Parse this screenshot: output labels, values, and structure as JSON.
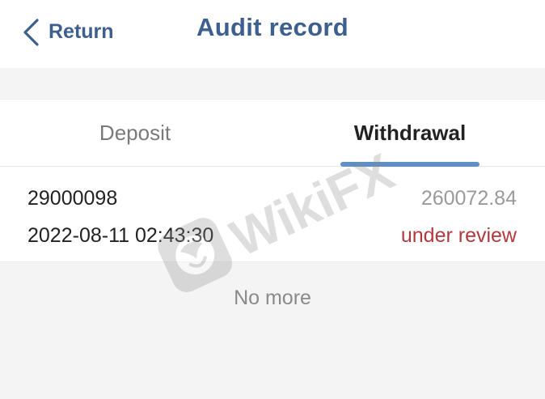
{
  "header": {
    "back_label": "Return",
    "title": "Audit record",
    "back_icon": "chevron-left-icon"
  },
  "tabs": [
    {
      "label": "Deposit",
      "active": false
    },
    {
      "label": "Withdrawal",
      "active": true
    }
  ],
  "records": [
    {
      "id": "29000098",
      "amount": "260072.84",
      "time": "2022-08-11 02:43:30",
      "status": "under review"
    }
  ],
  "footer": {
    "no_more": "No more"
  },
  "watermark": {
    "text": "WikiFX",
    "icon": "wikifx-logo-icon"
  },
  "colors": {
    "accent": "#3d5f8f",
    "tab_underline": "#5f8fc3",
    "status_review": "#b2383d",
    "page_bg": "#f4f4f4"
  }
}
